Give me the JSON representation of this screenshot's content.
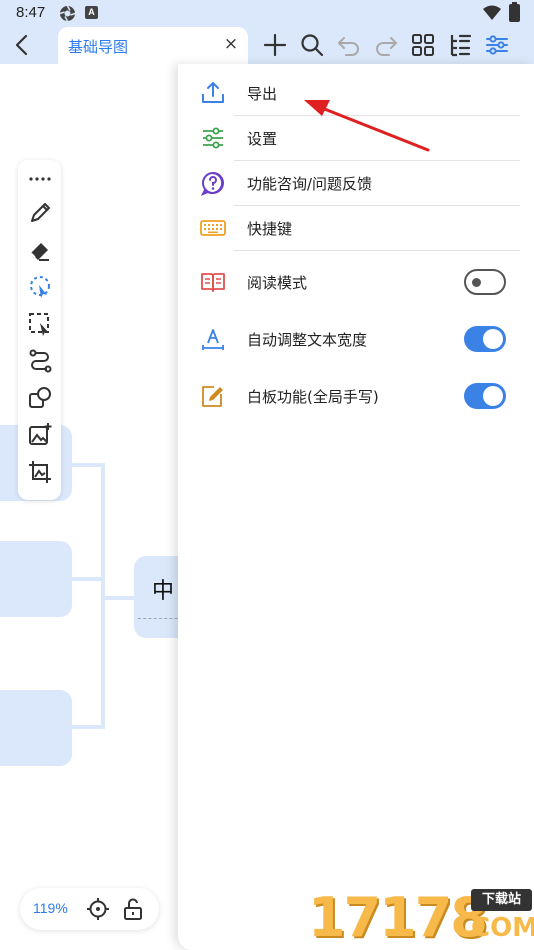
{
  "status_bar": {
    "time": "8:47",
    "app_badge": "A"
  },
  "toolbar": {
    "tab_title": "基础导图",
    "close_glyph": "×",
    "icons": [
      "add-icon",
      "search-icon",
      "undo-icon",
      "redo-icon",
      "grid-icon",
      "outline-icon",
      "sliders-icon"
    ]
  },
  "canvas": {
    "center_node_label": "中",
    "zoom_label": "119%"
  },
  "settings_panel": {
    "items": [
      {
        "label": "导出",
        "icon": "export-icon",
        "color": "#3b82e6"
      },
      {
        "label": "设置",
        "icon": "settings-sliders-icon",
        "color": "#3fa34d"
      },
      {
        "label": "功能咨询/问题反馈",
        "icon": "help-icon",
        "color": "#6a3fc8"
      },
      {
        "label": "快捷键",
        "icon": "keyboard-icon",
        "color": "#f0a020"
      }
    ],
    "toggles": [
      {
        "label": "阅读模式",
        "icon": "book-icon",
        "color": "#e05050",
        "state": "off"
      },
      {
        "label": "自动调整文本宽度",
        "icon": "text-width-icon",
        "color": "#3b82e6",
        "state": "on"
      },
      {
        "label": "白板功能(全局手写)",
        "icon": "whiteboard-pen-icon",
        "color": "#d08a20",
        "state": "on"
      }
    ]
  },
  "watermark": {
    "number": "17178",
    "badge": "下载站",
    "suffix": "COM"
  },
  "colors": {
    "accent": "#3b82e6",
    "node_fill": "#dbe8fb",
    "annotation_arrow": "#e02020"
  }
}
